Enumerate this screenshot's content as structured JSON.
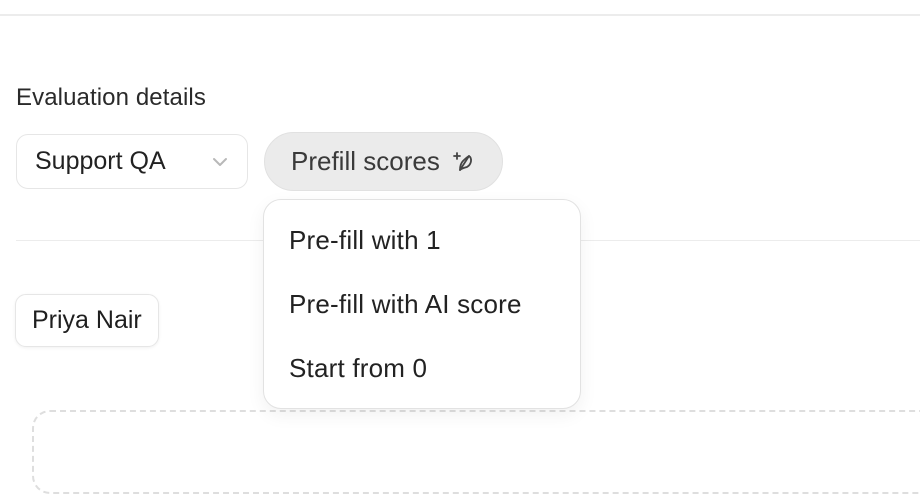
{
  "section": {
    "label": "Evaluation details"
  },
  "template_select": {
    "value": "Support QA",
    "icon": "chevron-down-icon"
  },
  "prefill_button": {
    "label": "Prefill scores",
    "icon": "sparkle-leaf-icon"
  },
  "prefill_menu": {
    "items": [
      {
        "label": "Pre-fill with 1"
      },
      {
        "label": "Pre-fill with AI score"
      },
      {
        "label": "Start from 0"
      }
    ]
  },
  "agent_chip": {
    "label": "Priya Nair"
  }
}
